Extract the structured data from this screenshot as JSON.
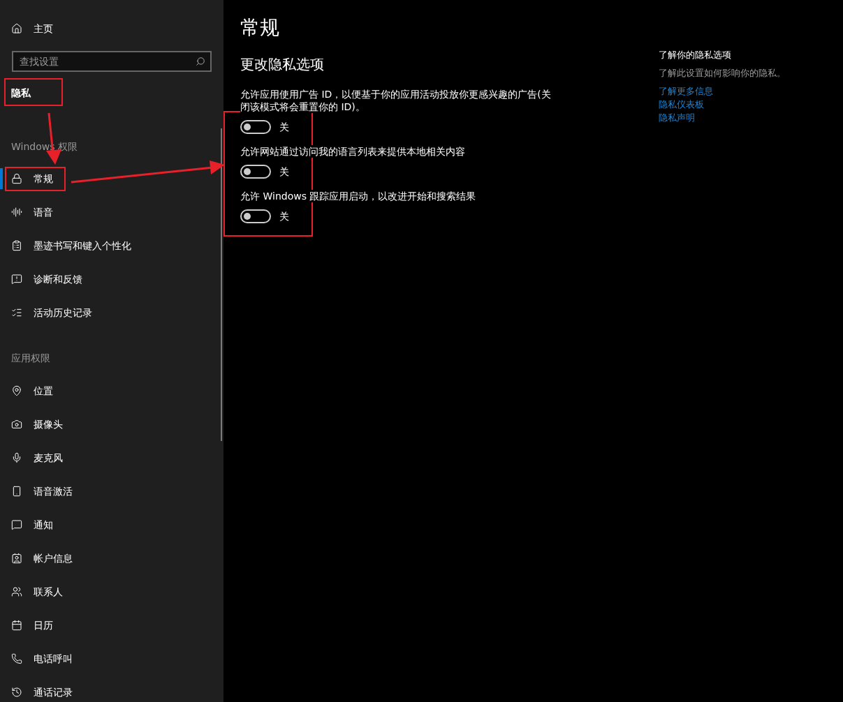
{
  "sidebar": {
    "home": {
      "label": "主页"
    },
    "search": {
      "placeholder": "查找设置"
    },
    "heading": "隐私",
    "sections": [
      {
        "label": "Windows 权限",
        "items": [
          {
            "label": "常规",
            "selected": true
          },
          {
            "label": "语音",
            "selected": false
          },
          {
            "label": "墨迹书写和键入个性化",
            "selected": false
          },
          {
            "label": "诊断和反馈",
            "selected": false
          },
          {
            "label": "活动历史记录",
            "selected": false
          }
        ]
      },
      {
        "label": "应用权限",
        "items": [
          {
            "label": "位置",
            "selected": false
          },
          {
            "label": "摄像头",
            "selected": false
          },
          {
            "label": "麦克风",
            "selected": false
          },
          {
            "label": "语音激活",
            "selected": false
          },
          {
            "label": "通知",
            "selected": false
          },
          {
            "label": "帐户信息",
            "selected": false
          },
          {
            "label": "联系人",
            "selected": false
          },
          {
            "label": "日历",
            "selected": false
          },
          {
            "label": "电话呼叫",
            "selected": false
          },
          {
            "label": "通话记录",
            "selected": false
          }
        ]
      }
    ]
  },
  "main": {
    "title": "常规",
    "subtitle": "更改隐私选项",
    "settings": [
      {
        "description": "允许应用使用广告 ID，以便基于你的应用活动投放你更感兴趣的广告(关闭该模式将会重置你的 ID)。",
        "on": false,
        "state_label": "关"
      },
      {
        "description": "允许网站通过访问我的语言列表来提供本地相关内容",
        "on": false,
        "state_label": "关"
      },
      {
        "description": "允许 Windows 跟踪应用启动，以改进开始和搜索结果",
        "on": false,
        "state_label": "关"
      }
    ]
  },
  "aside": {
    "title": "了解你的隐私选项",
    "description": "了解此设置如何影响你的隐私。",
    "links": [
      "了解更多信息",
      "隐私仪表板",
      "隐私声明"
    ]
  }
}
